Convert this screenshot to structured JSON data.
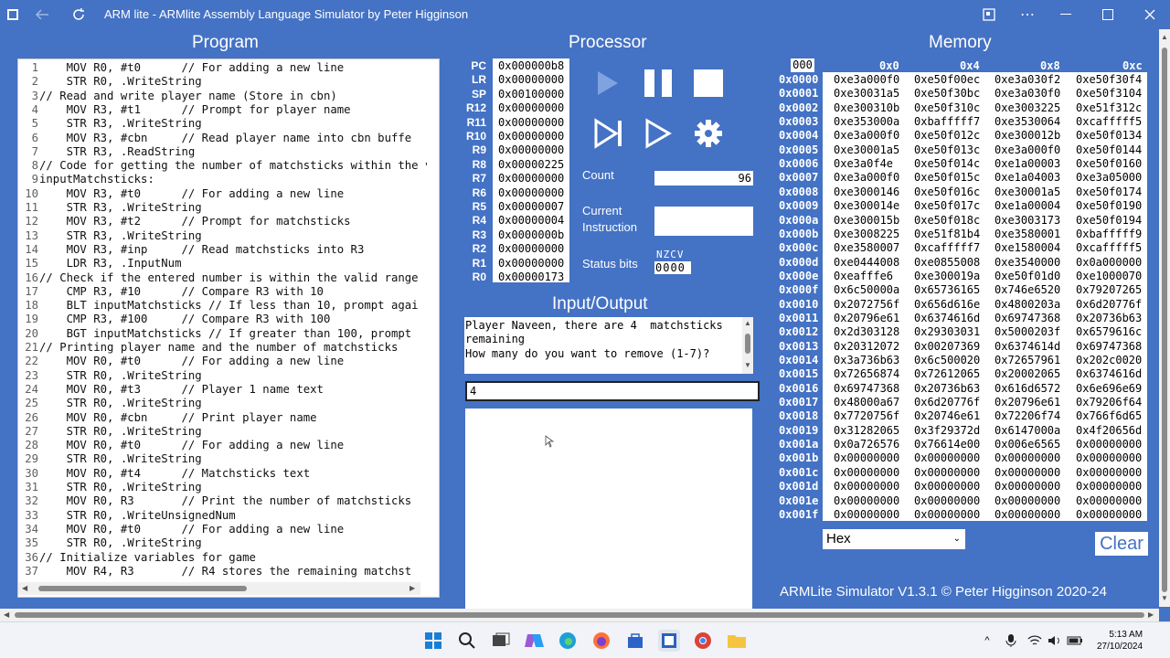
{
  "window": {
    "title": "ARM lite - ARMlite Assembly Language Simulator by Peter Higginson"
  },
  "headings": {
    "program": "Program",
    "processor": "Processor",
    "memory": "Memory",
    "io": "Input/Output"
  },
  "program": {
    "lines": [
      {
        "n": "1",
        "text": "    MOV R0, #t0      // For adding a new line"
      },
      {
        "n": "2",
        "text": "    STR R0, .WriteString"
      },
      {
        "n": "3",
        "text": "// Read and write player name (Store in cbn)"
      },
      {
        "n": "4",
        "text": "    MOV R3, #t1      // Prompt for player name"
      },
      {
        "n": "5",
        "text": "    STR R3, .WriteString"
      },
      {
        "n": "6",
        "text": "    MOV R3, #cbn     // Read player name into cbn buffe"
      },
      {
        "n": "7",
        "text": "    STR R3, .ReadString"
      },
      {
        "n": "8",
        "text": "// Code for getting the number of matchsticks within the v"
      },
      {
        "n": "9",
        "text": "inputMatchsticks:"
      },
      {
        "n": "10",
        "text": "    MOV R3, #t0      // For adding a new line"
      },
      {
        "n": "11",
        "text": "    STR R3, .WriteString"
      },
      {
        "n": "12",
        "text": "    MOV R3, #t2      // Prompt for matchsticks"
      },
      {
        "n": "13",
        "text": "    STR R3, .WriteString"
      },
      {
        "n": "14",
        "text": "    MOV R3, #inp     // Read matchsticks into R3"
      },
      {
        "n": "15",
        "text": "    LDR R3, .InputNum"
      },
      {
        "n": "16",
        "text": "// Check if the entered number is within the valid range ("
      },
      {
        "n": "17",
        "text": "    CMP R3, #10      // Compare R3 with 10"
      },
      {
        "n": "18",
        "text": "    BLT inputMatchsticks // If less than 10, prompt agai"
      },
      {
        "n": "19",
        "text": "    CMP R3, #100     // Compare R3 with 100"
      },
      {
        "n": "20",
        "text": "    BGT inputMatchsticks // If greater than 100, prompt"
      },
      {
        "n": "21",
        "text": "// Printing player name and the number of matchsticks"
      },
      {
        "n": "22",
        "text": "    MOV R0, #t0      // For adding a new line"
      },
      {
        "n": "23",
        "text": "    STR R0, .WriteString"
      },
      {
        "n": "24",
        "text": "    MOV R0, #t3      // Player 1 name text"
      },
      {
        "n": "25",
        "text": "    STR R0, .WriteString"
      },
      {
        "n": "26",
        "text": "    MOV R0, #cbn     // Print player name"
      },
      {
        "n": "27",
        "text": "    STR R0, .WriteString"
      },
      {
        "n": "28",
        "text": "    MOV R0, #t0      // For adding a new line"
      },
      {
        "n": "29",
        "text": "    STR R0, .WriteString"
      },
      {
        "n": "30",
        "text": "    MOV R0, #t4      // Matchsticks text"
      },
      {
        "n": "31",
        "text": "    STR R0, .WriteString"
      },
      {
        "n": "32",
        "text": "    MOV R0, R3       // Print the number of matchsticks"
      },
      {
        "n": "33",
        "text": "    STR R0, .WriteUnsignedNum"
      },
      {
        "n": "34",
        "text": "    MOV R0, #t0      // For adding a new line"
      },
      {
        "n": "35",
        "text": "    STR R0, .WriteString"
      },
      {
        "n": "36",
        "text": "// Initialize variables for game"
      },
      {
        "n": "37",
        "text": "    MOV R4, R3       // R4 stores the remaining matchst"
      }
    ]
  },
  "registers": [
    {
      "name": "PC",
      "value": "0x000000b8"
    },
    {
      "name": "LR",
      "value": "0x00000000"
    },
    {
      "name": "SP",
      "value": "0x00100000"
    },
    {
      "name": "R12",
      "value": "0x00000000"
    },
    {
      "name": "R11",
      "value": "0x00000000"
    },
    {
      "name": "R10",
      "value": "0x00000000"
    },
    {
      "name": "R9",
      "value": "0x00000000"
    },
    {
      "name": "R8",
      "value": "0x00000225"
    },
    {
      "name": "R7",
      "value": "0x00000000"
    },
    {
      "name": "R6",
      "value": "0x00000000"
    },
    {
      "name": "R5",
      "value": "0x00000007"
    },
    {
      "name": "R4",
      "value": "0x00000004"
    },
    {
      "name": "R3",
      "value": "0x0000000b"
    },
    {
      "name": "R2",
      "value": "0x00000000"
    },
    {
      "name": "R1",
      "value": "0x00000000"
    },
    {
      "name": "R0",
      "value": "0x00000173"
    }
  ],
  "processor": {
    "count_label": "Count",
    "count_value": "96",
    "current_instruction_label_1": "Current",
    "current_instruction_label_2": "Instruction",
    "current_instruction_value": "",
    "status_label": "Status bits",
    "status_flags": "NZCV",
    "status_value": "0000"
  },
  "io": {
    "output": "Player Naveen, there are 4  matchsticks remaining\nHow many do you want to remove (1-7)?",
    "input_value": "4"
  },
  "memory": {
    "address_input": "000",
    "columns": [
      "0x0",
      "0x4",
      "0x8",
      "0xc"
    ],
    "rows": [
      {
        "addr": "0x0000",
        "cells": [
          "0xe3a000f0",
          "0xe50f00ec",
          "0xe3a030f2",
          "0xe50f30f4"
        ]
      },
      {
        "addr": "0x0001",
        "cells": [
          "0xe30031a5",
          "0xe50f30bc",
          "0xe3a030f0",
          "0xe50f3104"
        ]
      },
      {
        "addr": "0x0002",
        "cells": [
          "0xe300310b",
          "0xe50f310c",
          "0xe3003225",
          "0xe51f312c"
        ]
      },
      {
        "addr": "0x0003",
        "cells": [
          "0xe353000a",
          "0xbafffff7",
          "0xe3530064",
          "0xcafffff5"
        ]
      },
      {
        "addr": "0x0004",
        "cells": [
          "0xe3a000f0",
          "0xe50f012c",
          "0xe300012b",
          "0xe50f0134"
        ]
      },
      {
        "addr": "0x0005",
        "cells": [
          "0xe30001a5",
          "0xe50f013c",
          "0xe3a000f0",
          "0xe50f0144"
        ]
      },
      {
        "addr": "0x0006",
        "cells": [
          "0xe3a0f4e",
          "0xe50f014c",
          "0xe1a00003",
          "0xe50f0160"
        ]
      },
      {
        "addr": "0x0007",
        "cells": [
          "0xe3a000f0",
          "0xe50f015c",
          "0xe1a04003",
          "0xe3a05000"
        ]
      },
      {
        "addr": "0x0008",
        "cells": [
          "0xe3000146",
          "0xe50f016c",
          "0xe30001a5",
          "0xe50f0174"
        ]
      },
      {
        "addr": "0x0009",
        "cells": [
          "0xe300014e",
          "0xe50f017c",
          "0xe1a00004",
          "0xe50f0190"
        ]
      },
      {
        "addr": "0x000a",
        "cells": [
          "0xe300015b",
          "0xe50f018c",
          "0xe3003173",
          "0xe50f0194"
        ]
      },
      {
        "addr": "0x000b",
        "cells": [
          "0xe3008225",
          "0xe51f81b4",
          "0xe3580001",
          "0xbafffff9"
        ]
      },
      {
        "addr": "0x000c",
        "cells": [
          "0xe3580007",
          "0xcafffff7",
          "0xe1580004",
          "0xcafffff5"
        ]
      },
      {
        "addr": "0x000d",
        "cells": [
          "0xe0444008",
          "0xe0855008",
          "0xe3540000",
          "0x0a000000"
        ]
      },
      {
        "addr": "0x000e",
        "cells": [
          "0xeafffe6",
          "0xe300019a",
          "0xe50f01d0",
          "0xe1000070"
        ]
      },
      {
        "addr": "0x000f",
        "cells": [
          "0x6c50000a",
          "0x65736165",
          "0x746e6520",
          "0x79207265"
        ]
      },
      {
        "addr": "0x0010",
        "cells": [
          "0x2072756f",
          "0x656d616e",
          "0x4800203a",
          "0x6d20776f"
        ]
      },
      {
        "addr": "0x0011",
        "cells": [
          "0x20796e61",
          "0x6374616d",
          "0x69747368",
          "0x20736b63"
        ]
      },
      {
        "addr": "0x0012",
        "cells": [
          "0x2d303128",
          "0x29303031",
          "0x5000203f",
          "0x6579616c"
        ]
      },
      {
        "addr": "0x0013",
        "cells": [
          "0x20312072",
          "0x00207369",
          "0x6374614d",
          "0x69747368"
        ]
      },
      {
        "addr": "0x0014",
        "cells": [
          "0x3a736b63",
          "0x6c500020",
          "0x72657961",
          "0x202c0020"
        ]
      },
      {
        "addr": "0x0015",
        "cells": [
          "0x72656874",
          "0x72612065",
          "0x20002065",
          "0x6374616d"
        ]
      },
      {
        "addr": "0x0016",
        "cells": [
          "0x69747368",
          "0x20736b63",
          "0x616d6572",
          "0x6e696e69"
        ]
      },
      {
        "addr": "0x0017",
        "cells": [
          "0x48000a67",
          "0x6d20776f",
          "0x20796e61",
          "0x79206f64"
        ]
      },
      {
        "addr": "0x0018",
        "cells": [
          "0x7720756f",
          "0x20746e61",
          "0x72206f74",
          "0x766f6d65"
        ]
      },
      {
        "addr": "0x0019",
        "cells": [
          "0x31282065",
          "0x3f29372d",
          "0x6147000a",
          "0x4f20656d"
        ]
      },
      {
        "addr": "0x001a",
        "cells": [
          "0x0a726576",
          "0x76614e00",
          "0x006e6565",
          "0x00000000"
        ]
      },
      {
        "addr": "0x001b",
        "cells": [
          "0x00000000",
          "0x00000000",
          "0x00000000",
          "0x00000000"
        ]
      },
      {
        "addr": "0x001c",
        "cells": [
          "0x00000000",
          "0x00000000",
          "0x00000000",
          "0x00000000"
        ]
      },
      {
        "addr": "0x001d",
        "cells": [
          "0x00000000",
          "0x00000000",
          "0x00000000",
          "0x00000000"
        ]
      },
      {
        "addr": "0x001e",
        "cells": [
          "0x00000000",
          "0x00000000",
          "0x00000000",
          "0x00000000"
        ]
      },
      {
        "addr": "0x001f",
        "cells": [
          "0x00000000",
          "0x00000000",
          "0x00000000",
          "0x00000000"
        ]
      }
    ],
    "format": "Hex",
    "clear_label": "Clear"
  },
  "footer": {
    "version": "ARMLite Simulator V1.3.1 © Peter Higginson 2020-24"
  },
  "taskbar": {
    "time": "5:13 AM",
    "date": "27/10/2024"
  },
  "colors": {
    "background": "#4472c4",
    "panel": "#ffffff",
    "play_disabled": "#7fa3e0"
  }
}
